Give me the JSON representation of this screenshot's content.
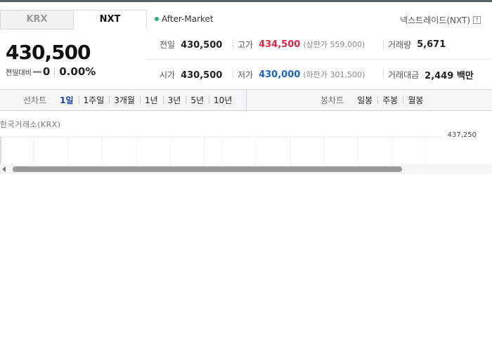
{
  "tabs": [
    {
      "label": "KRX",
      "active": false
    },
    {
      "label": "NXT",
      "active": true
    }
  ],
  "session": {
    "label": "After-Market",
    "dot_color": "#22b573"
  },
  "exchange": {
    "label": "넥스트레이드(NXT)",
    "help_icon": "?"
  },
  "price": {
    "current": "430,500",
    "change_label": "전일대비",
    "change_value": "0",
    "change_rate": "0.00%"
  },
  "quotes": {
    "prev_close": {
      "label": "전일",
      "value": "430,500"
    },
    "high": {
      "label": "고가",
      "value": "434,500",
      "sub_prefix": "(상한가",
      "sub_value": "559,000",
      "sub_suffix": ")"
    },
    "volume": {
      "label": "거래량",
      "value": "5,671"
    },
    "open": {
      "label": "시가",
      "value": "430,500"
    },
    "low": {
      "label": "저가",
      "value": "430,000",
      "sub_prefix": "(하한가",
      "sub_value": "301,500",
      "sub_suffix": ")"
    },
    "amount": {
      "label": "거래대금",
      "value": "2,449 백만"
    }
  },
  "line_chart": {
    "title": "선차트",
    "periods": [
      "1일",
      "1주일",
      "3개월",
      "1년",
      "3년",
      "5년",
      "10년"
    ],
    "active": "1일"
  },
  "candle_chart": {
    "title": "봉차트",
    "periods": [
      "일봉",
      "주봉",
      "월봉"
    ]
  },
  "chart": {
    "source_label": "한국거래소(KRX)",
    "y_tick": "437,250"
  },
  "colors": {
    "up": "#e12343",
    "down": "#1a63c6",
    "active_tab": "#1a3fa8"
  }
}
